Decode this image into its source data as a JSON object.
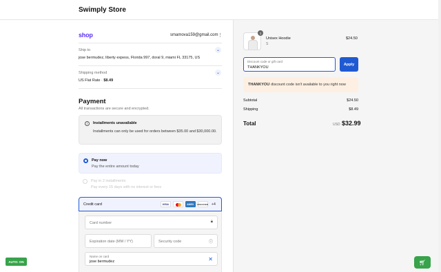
{
  "header": {
    "store_name": "Swimply Store"
  },
  "account": {
    "logo_text": "shop",
    "email": "smamova159@gmail.com",
    "menu_glyph": "⋮"
  },
  "ship_to": {
    "label": "Ship to",
    "value": "jose bermudez, liberty expess, Florida 997, doral 9, miami FL 33175, US"
  },
  "shipping_method": {
    "label": "Shipping method",
    "name": "US Flat Rate · ",
    "price": "$8.49"
  },
  "payment": {
    "title": "Payment",
    "subtitle": "All transactions are secure and encrypted.",
    "notice": {
      "title": "Installments unavailable",
      "body": "Installments can only be used for orders between $35.00 and $30,000.00."
    },
    "options": [
      {
        "title": "Pay now",
        "subtitle": "Pay the entire amount today",
        "selected": true
      },
      {
        "title": "Pay in 2 installments",
        "subtitle": "Pay every 15 days with no interest or fees",
        "selected": false
      }
    ],
    "credit_card": {
      "label": "Credit card",
      "brands": [
        "VISA",
        "MC",
        "AMEX",
        "DISCOVER"
      ],
      "more": "+4",
      "card_number_placeholder": "Card number",
      "expiration_placeholder": "Expiration date (MM / YY)",
      "security_placeholder": "Security code",
      "name_label": "Name on card",
      "name_value": "jose bermudez"
    }
  },
  "auto_toggle": "AUTO: ON",
  "order": {
    "item": {
      "name": "Unisex Hoodie",
      "variant": "S",
      "quantity": "1",
      "price": "$24.50"
    },
    "discount": {
      "label": "Discount code or gift card",
      "value": "THANKYOU",
      "apply_label": "Apply"
    },
    "error": {
      "code": "THANKYOU",
      "message": "discount code isn't available to you right now"
    },
    "subtotal_label": "Subtotal",
    "subtotal": "$24.50",
    "shipping_label": "Shipping",
    "shipping": "$8.49",
    "total_label": "Total",
    "currency": "USD",
    "total": "$32.99"
  },
  "colors": {
    "accent": "#1f5ad2",
    "shop_brand": "#5a31f4",
    "green": "#37a34a",
    "error_bg": "#fdf0e3"
  }
}
